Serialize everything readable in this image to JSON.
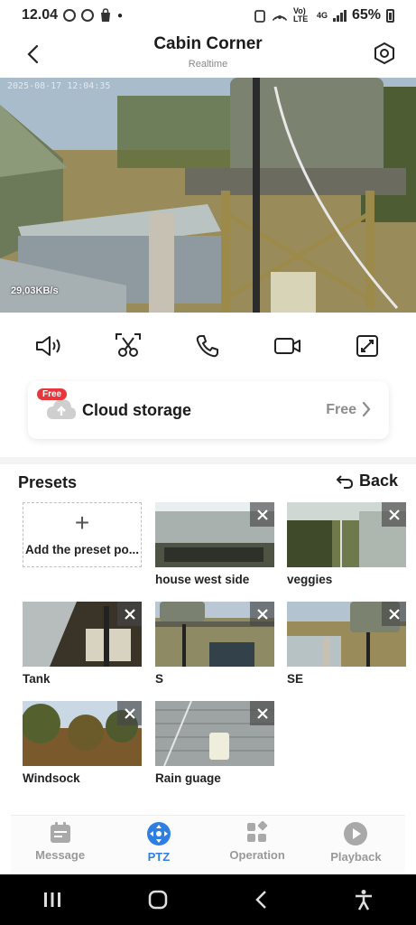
{
  "status_bar": {
    "time": "12.04",
    "network": "4G",
    "volte": "Vo) LTE",
    "battery": "65%"
  },
  "header": {
    "title": "Cabin Corner",
    "subtitle": "Realtime"
  },
  "video": {
    "timestamp": "2025-08-17 12:04:35",
    "bitrate": "29,03KB/s"
  },
  "controls": [
    {
      "icon": "speaker-icon"
    },
    {
      "icon": "scissors-icon"
    },
    {
      "icon": "phone-icon"
    },
    {
      "icon": "record-icon"
    },
    {
      "icon": "fullscreen-icon"
    }
  ],
  "cloud": {
    "badge": "Free",
    "label": "Cloud storage",
    "status": "Free"
  },
  "presets": {
    "title": "Presets",
    "back_label": "Back",
    "add_label": "Add the preset po...",
    "items": [
      {
        "label": "house west side",
        "scene": "roof"
      },
      {
        "label": "veggies",
        "scene": "garden"
      },
      {
        "label": "Tank",
        "scene": "tank-close"
      },
      {
        "label": "S",
        "scene": "tank-s"
      },
      {
        "label": "SE",
        "scene": "tank-se"
      },
      {
        "label": "Windsock",
        "scene": "trees"
      },
      {
        "label": "Rain guage",
        "scene": "gauge"
      }
    ]
  },
  "nav": {
    "active": "PTZ",
    "items": [
      {
        "label": "Message",
        "icon": "message-icon"
      },
      {
        "label": "PTZ",
        "icon": "ptz-icon"
      },
      {
        "label": "Operation",
        "icon": "operation-icon"
      },
      {
        "label": "Playback",
        "icon": "playback-icon"
      }
    ]
  },
  "colors": {
    "accent": "#2f7fe3",
    "badge": "#e8363d",
    "inactive": "#999999"
  }
}
